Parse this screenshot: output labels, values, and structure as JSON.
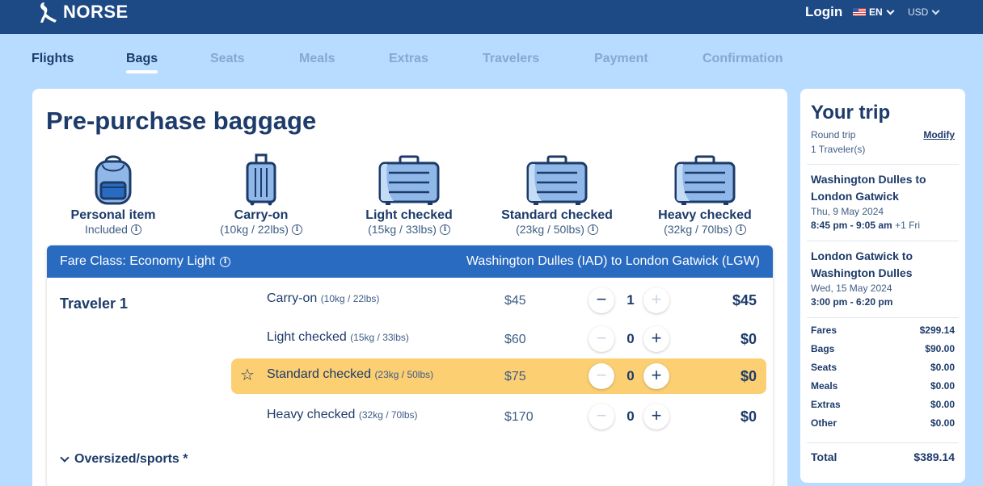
{
  "header": {
    "brand": "NORSE",
    "login_label": "Login",
    "language": "EN",
    "currency": "USD"
  },
  "steps": [
    {
      "label": "Flights",
      "state": "done"
    },
    {
      "label": "Bags",
      "state": "active"
    },
    {
      "label": "Seats",
      "state": "upcoming"
    },
    {
      "label": "Meals",
      "state": "upcoming"
    },
    {
      "label": "Extras",
      "state": "upcoming"
    },
    {
      "label": "Travelers",
      "state": "upcoming"
    },
    {
      "label": "Payment",
      "state": "upcoming"
    },
    {
      "label": "Confirmation",
      "state": "upcoming"
    }
  ],
  "main": {
    "title": "Pre-purchase baggage",
    "bag_options": [
      {
        "name": "Personal item",
        "detail": "Included",
        "icon": "backpack-icon"
      },
      {
        "name": "Carry-on",
        "detail": "(10kg / 22lbs)",
        "icon": "carry-on-icon"
      },
      {
        "name": "Light checked",
        "detail": "(15kg / 33lbs)",
        "icon": "suitcase-icon"
      },
      {
        "name": "Standard checked",
        "detail": "(23kg / 50lbs)",
        "icon": "suitcase-icon"
      },
      {
        "name": "Heavy checked",
        "detail": "(32kg / 70lbs)",
        "icon": "suitcase-icon"
      }
    ],
    "fare": {
      "class_label": "Fare Class: Economy Light",
      "route": "Washington Dulles (IAD) to London Gatwick (LGW)",
      "traveler": "Traveler 1",
      "oversized_label": "Oversized/sports *",
      "rows": [
        {
          "name": "Carry-on",
          "weight": "(10kg / 22lbs)",
          "price": "$45",
          "qty": "1",
          "total": "$45",
          "highlight": false,
          "minus_enabled": true,
          "plus_enabled": false
        },
        {
          "name": "Light checked",
          "weight": "(15kg / 33lbs)",
          "price": "$60",
          "qty": "0",
          "total": "$0",
          "highlight": false,
          "minus_enabled": false,
          "plus_enabled": true
        },
        {
          "name": "Standard checked",
          "weight": "(23kg / 50lbs)",
          "price": "$75",
          "qty": "0",
          "total": "$0",
          "highlight": true,
          "minus_enabled": false,
          "plus_enabled": true
        },
        {
          "name": "Heavy checked",
          "weight": "(32kg / 70lbs)",
          "price": "$170",
          "qty": "0",
          "total": "$0",
          "highlight": false,
          "minus_enabled": false,
          "plus_enabled": true
        }
      ]
    }
  },
  "trip": {
    "title": "Your trip",
    "type": "Round trip",
    "travelers": "1 Traveler(s)",
    "modify_label": "Modify",
    "segments": [
      {
        "route": "Washington Dulles to London Gatwick",
        "date": "Thu, 9 May 2024",
        "time": "8:45 pm - 9:05 am",
        "extra": "+1 Fri"
      },
      {
        "route": "London Gatwick to Washington Dulles",
        "date": "Wed, 15 May 2024",
        "time": "3:00 pm - 6:20 pm",
        "extra": ""
      }
    ],
    "costs": [
      {
        "label": "Fares",
        "value": "$299.14"
      },
      {
        "label": "Bags",
        "value": "$90.00"
      },
      {
        "label": "Seats",
        "value": "$0.00"
      },
      {
        "label": "Meals",
        "value": "$0.00"
      },
      {
        "label": "Extras",
        "value": "$0.00"
      },
      {
        "label": "Other",
        "value": "$0.00"
      }
    ],
    "total_label": "Total",
    "total_value": "$389.14"
  },
  "colors": {
    "page_bg": "#b7dcff",
    "header_bg": "#1d4a85",
    "fare_header_bg": "#2a6bc2",
    "highlight_row": "#fbcf72",
    "text_primary": "#1d3b6a"
  }
}
